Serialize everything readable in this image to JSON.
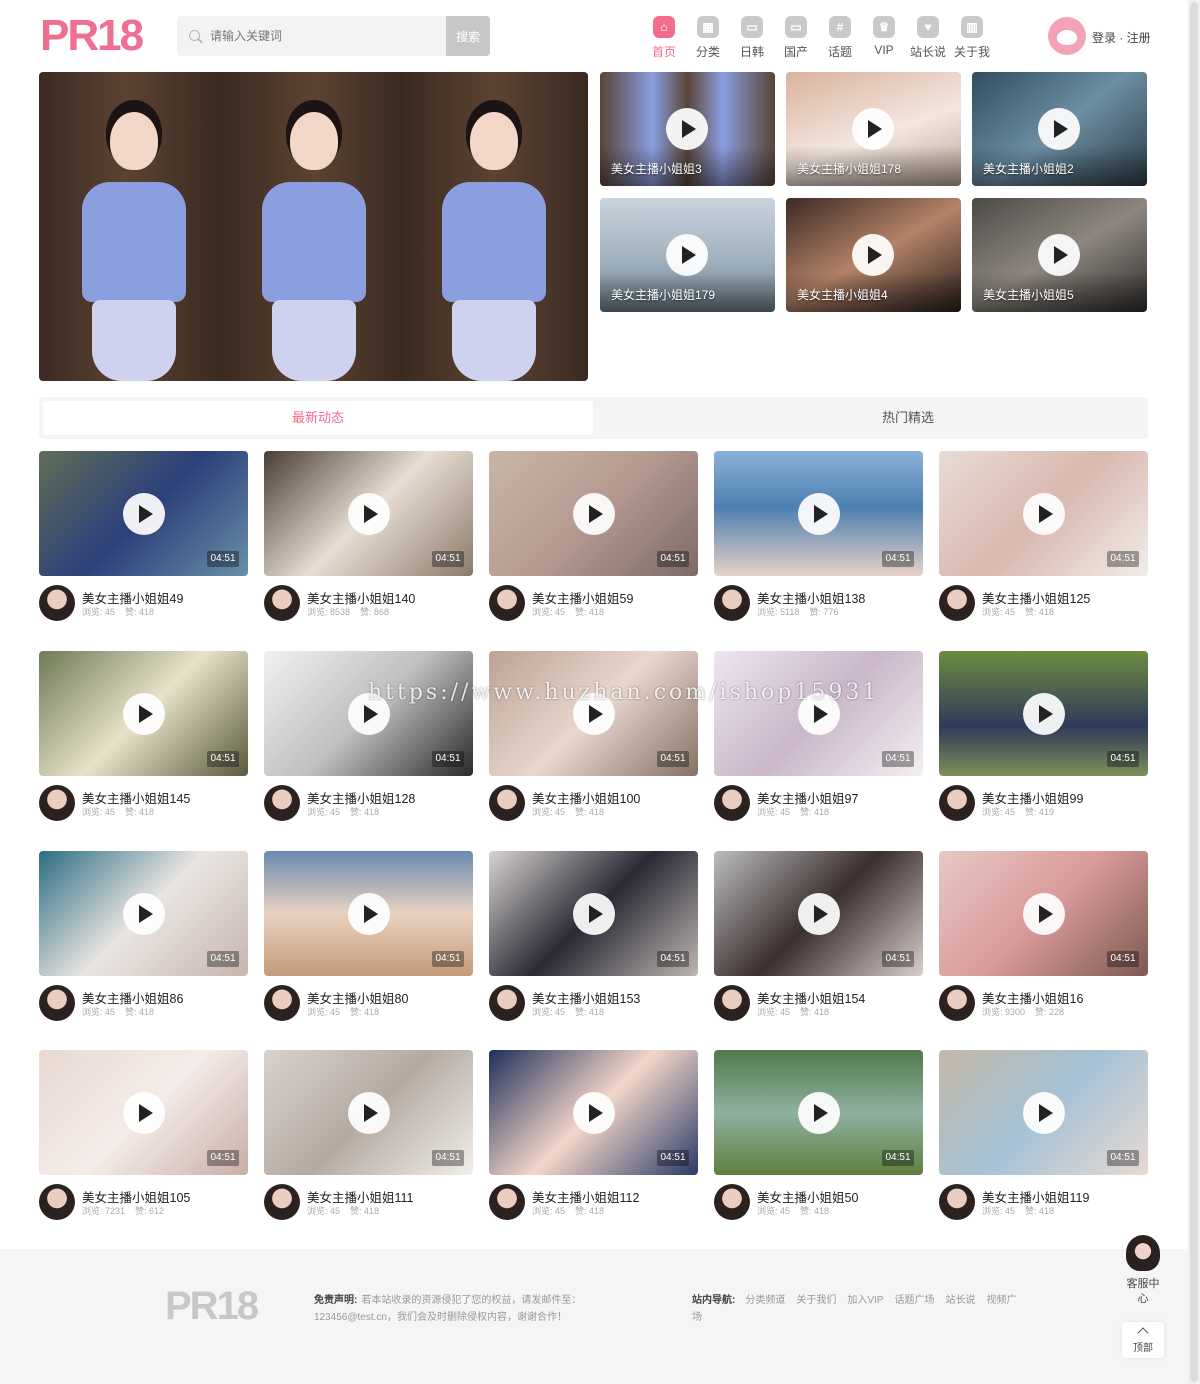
{
  "header": {
    "logo": "PR18",
    "search_placeholder": "请输入关键词",
    "search_button": "搜索",
    "nav": [
      {
        "label": "首页",
        "icon": "home-icon",
        "glyph": "⌂",
        "active": true
      },
      {
        "label": "分类",
        "icon": "grid-icon",
        "glyph": "▦",
        "active": false
      },
      {
        "label": "日韩",
        "icon": "tv-icon",
        "glyph": "▭",
        "active": false
      },
      {
        "label": "国产",
        "icon": "tv-icon",
        "glyph": "▭",
        "active": false
      },
      {
        "label": "话题",
        "icon": "hashtag-icon",
        "glyph": "#",
        "active": false
      },
      {
        "label": "VIP",
        "icon": "crown-icon",
        "glyph": "♛",
        "active": false
      },
      {
        "label": "站长说",
        "icon": "heart-chat-icon",
        "glyph": "♥",
        "active": false
      },
      {
        "label": "关于我",
        "icon": "building-icon",
        "glyph": "▥",
        "active": false
      }
    ],
    "login": "登录 · 注册"
  },
  "hero": {
    "slides": 3,
    "active_slide": 1
  },
  "featured": [
    {
      "title": "美女主播小姐姐3"
    },
    {
      "title": "美女主播小姐姐178"
    },
    {
      "title": "美女主播小姐姐2"
    },
    {
      "title": "美女主播小姐姐179"
    },
    {
      "title": "美女主播小姐姐4"
    },
    {
      "title": "美女主播小姐姐5"
    }
  ],
  "tabs": [
    {
      "label": "最新动态",
      "active": true
    },
    {
      "label": "热门精选",
      "active": false
    }
  ],
  "videos": [
    {
      "title": "美女主播小姐姐49",
      "duration": "04:51",
      "views": "浏览: 45",
      "likes": "赞: 418"
    },
    {
      "title": "美女主播小姐姐140",
      "duration": "04:51",
      "views": "浏览: 8538",
      "likes": "赞: 868"
    },
    {
      "title": "美女主播小姐姐59",
      "duration": "04:51",
      "views": "浏览: 45",
      "likes": "赞: 418"
    },
    {
      "title": "美女主播小姐姐138",
      "duration": "04:51",
      "views": "浏览: 5118",
      "likes": "赞: 776"
    },
    {
      "title": "美女主播小姐姐125",
      "duration": "04:51",
      "views": "浏览: 45",
      "likes": "赞: 418"
    },
    {
      "title": "美女主播小姐姐145",
      "duration": "04:51",
      "views": "浏览: 45",
      "likes": "赞: 418"
    },
    {
      "title": "美女主播小姐姐128",
      "duration": "04:51",
      "views": "浏览: 45",
      "likes": "赞: 418"
    },
    {
      "title": "美女主播小姐姐100",
      "duration": "04:51",
      "views": "浏览: 45",
      "likes": "赞: 418"
    },
    {
      "title": "美女主播小姐姐97",
      "duration": "04:51",
      "views": "浏览: 45",
      "likes": "赞: 418"
    },
    {
      "title": "美女主播小姐姐99",
      "duration": "04:51",
      "views": "浏览: 45",
      "likes": "赞: 419"
    },
    {
      "title": "美女主播小姐姐86",
      "duration": "04:51",
      "views": "浏览: 45",
      "likes": "赞: 418"
    },
    {
      "title": "美女主播小姐姐80",
      "duration": "04:51",
      "views": "浏览: 45",
      "likes": "赞: 418"
    },
    {
      "title": "美女主播小姐姐153",
      "duration": "04:51",
      "views": "浏览: 45",
      "likes": "赞: 418"
    },
    {
      "title": "美女主播小姐姐154",
      "duration": "04:51",
      "views": "浏览: 45",
      "likes": "赞: 418"
    },
    {
      "title": "美女主播小姐姐16",
      "duration": "04:51",
      "views": "浏览: 9300",
      "likes": "赞: 228"
    },
    {
      "title": "美女主播小姐姐105",
      "duration": "04:51",
      "views": "浏览: 7231",
      "likes": "赞: 612"
    },
    {
      "title": "美女主播小姐姐111",
      "duration": "04:51",
      "views": "浏览: 45",
      "likes": "赞: 418"
    },
    {
      "title": "美女主播小姐姐112",
      "duration": "04:51",
      "views": "浏览: 45",
      "likes": "赞: 418"
    },
    {
      "title": "美女主播小姐姐50",
      "duration": "04:51",
      "views": "浏览: 45",
      "likes": "赞: 418"
    },
    {
      "title": "美女主播小姐姐119",
      "duration": "04:51",
      "views": "浏览: 45",
      "likes": "赞: 418"
    }
  ],
  "watermark": "https://www.huzhan.com/ishop15931",
  "footer": {
    "logo": "PR18",
    "disclaimer_label": "免责声明:",
    "disclaimer_text": "若本站收录的资源侵犯了您的权益，请发邮件至：123456@test.cn，我们会及时删除侵权内容，谢谢合作！",
    "nav_label": "站内导航:",
    "nav_links": [
      "分类频道",
      "关于我们",
      "加入VIP",
      "话题广场",
      "站长说",
      "视频广场"
    ]
  },
  "side": {
    "service": "客服中心",
    "top": "顶部"
  },
  "colors": {
    "accent": "#f26d8c",
    "logo": "#ee6f8f",
    "footer_bg": "#f5f5f5"
  }
}
